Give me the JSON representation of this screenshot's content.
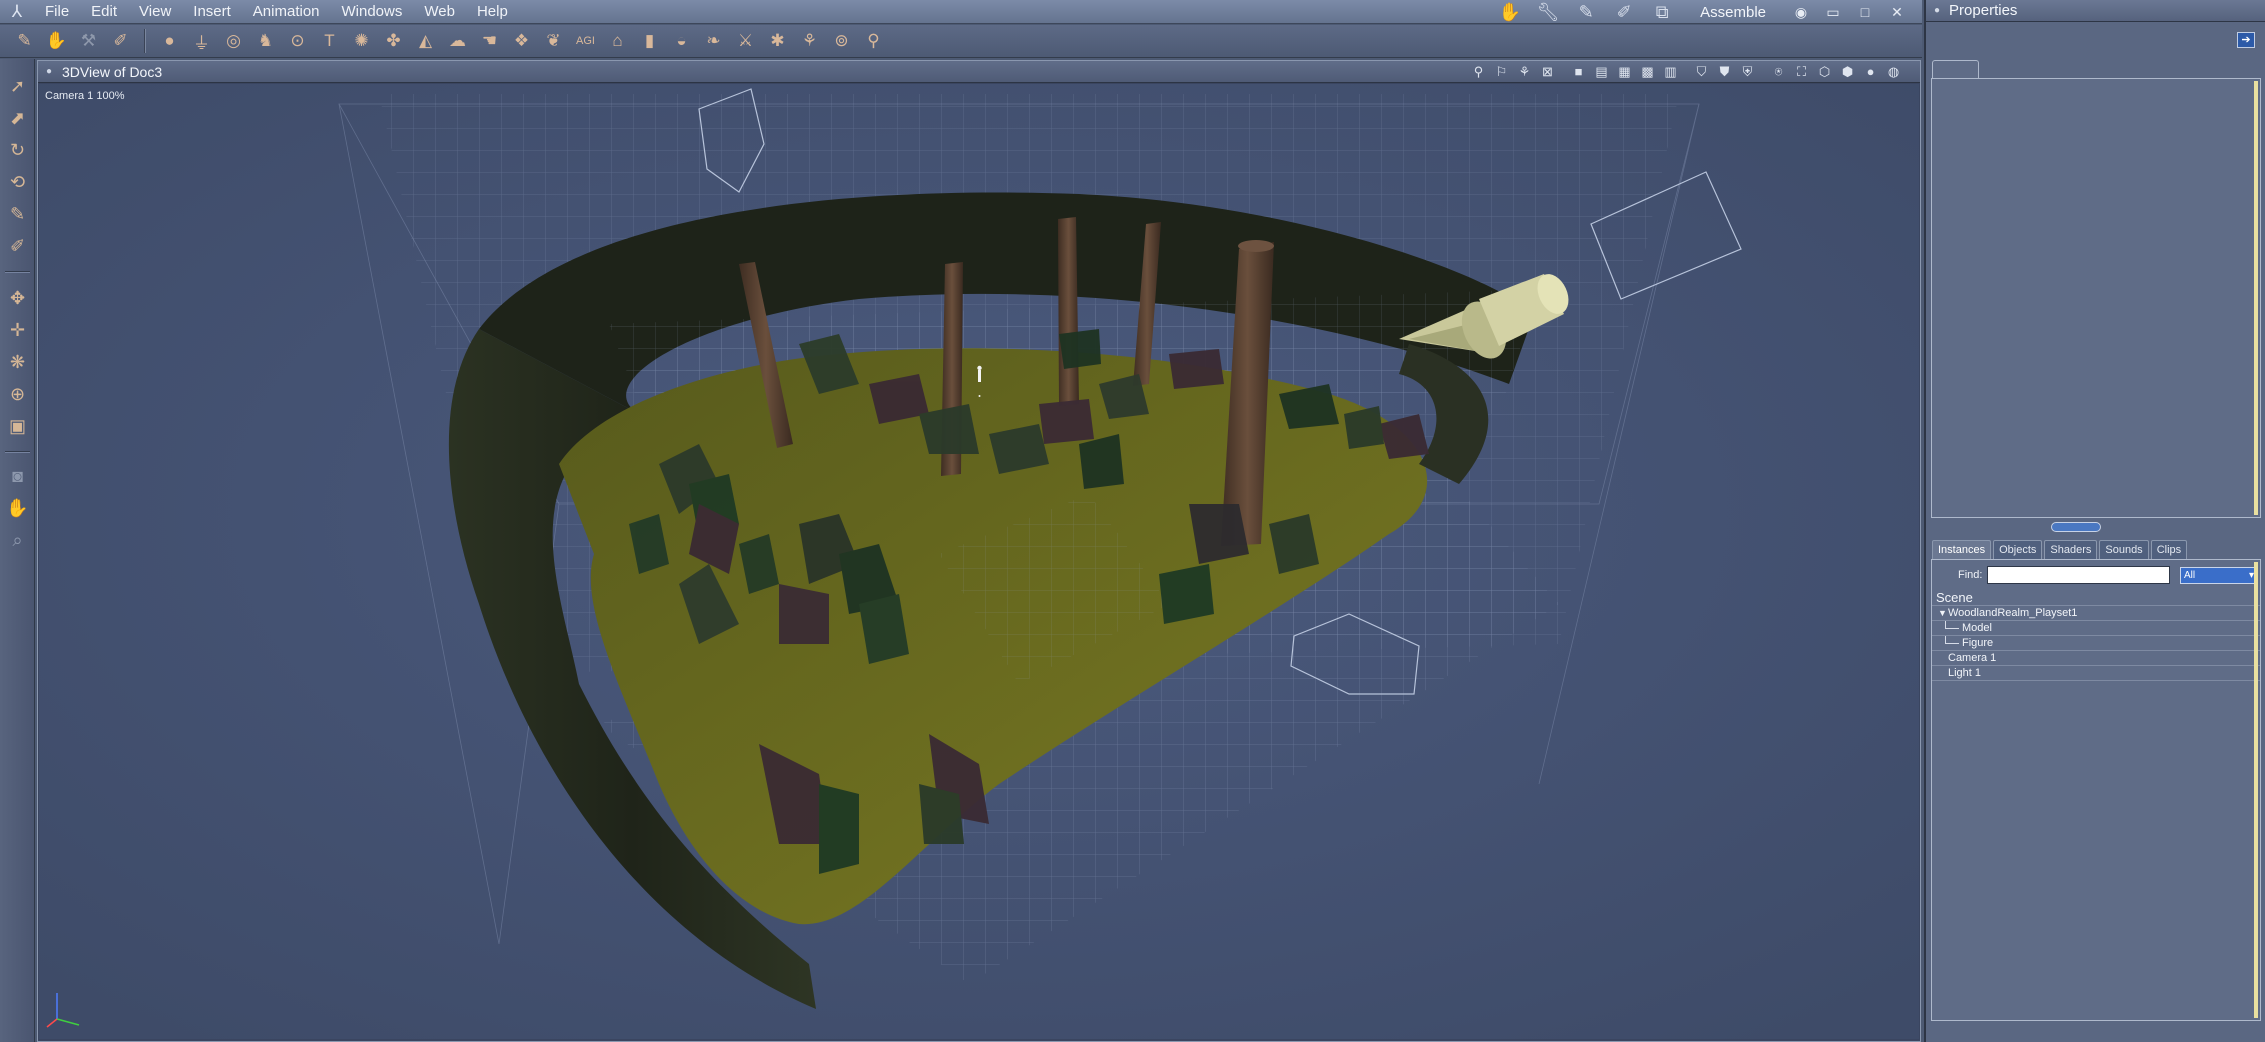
{
  "menubar": {
    "items": [
      "File",
      "Edit",
      "View",
      "Insert",
      "Animation",
      "Windows",
      "Web",
      "Help"
    ],
    "room_label": "Assemble",
    "room_icons": [
      "hand-pose-icon",
      "wrench-icon",
      "brush-icon",
      "paint-brush-icon",
      "materials-icon"
    ],
    "window_buttons": [
      "eye-icon",
      "minimize-icon",
      "maximize-icon",
      "close-icon"
    ]
  },
  "toolbar": {
    "groups": [
      [
        "pencil-icon",
        "hand-icon",
        "wrench-icon",
        "brush-icon"
      ],
      [
        "sphere-icon",
        "cylinder-icon",
        "torus-icon",
        "figure-icon",
        "ring-icon",
        "text-3d-icon",
        "gear-icon",
        "tree-icon",
        "terrain-icon",
        "cloud-icon",
        "hand-prop-icon",
        "rock-icon",
        "plant-icon",
        "agi-icon",
        "house-icon",
        "bottle-icon",
        "bowl-icon",
        "leaf-icon",
        "sword-icon",
        "bug-icon",
        "bones-icon",
        "target-icon",
        "pin-icon"
      ]
    ]
  },
  "lefttools": {
    "icons": [
      "select-arrow-icon",
      "transform-icon",
      "rotate-icon",
      "twist-icon",
      "brush-tool-icon",
      "paint-icon",
      "move-icon",
      "translate-xy-icon",
      "scale-icon",
      "universal-icon",
      "box-tool-icon",
      "camera-icon",
      "pan-hand-icon",
      "zoom-icon"
    ]
  },
  "viewport": {
    "title": "3DView of Doc3",
    "camera_label": "Camera 1  100%",
    "icons": [
      "snap-icon",
      "light-icon",
      "bones-view-icon",
      "close-view-icon",
      "single-view-icon",
      "two-view-icon",
      "three-view-icon",
      "four-view-icon",
      "six-view-icon",
      "display-mode-1-icon",
      "display-mode-2-icon",
      "display-mode-3-icon",
      "orbit-icon",
      "frame-icon",
      "cube-icon",
      "cube-solid-icon",
      "shaded-sphere-icon",
      "wire-sphere-icon"
    ]
  },
  "properties": {
    "title": "Properties",
    "tab_label": ""
  },
  "instances": {
    "tabs": [
      "Instances",
      "Objects",
      "Shaders",
      "Sounds",
      "Clips"
    ],
    "active_tab": "Instances",
    "find_label": "Find:",
    "find_value": "",
    "filter_value": "All",
    "scene_header": "Scene",
    "tree": [
      {
        "label": "WoodlandRealm_Playset1",
        "depth": 0,
        "expanded": true
      },
      {
        "label": "Model",
        "depth": 1
      },
      {
        "label": "Figure",
        "depth": 1
      },
      {
        "label": "Camera 1",
        "depth": 0
      },
      {
        "label": "Light 1",
        "depth": 0
      }
    ]
  },
  "colors": {
    "ground": "#6b6b1f",
    "wall": "#2a3020",
    "trunk": "#5e4635",
    "grid": "#8a98b8",
    "light": "#c7c79a"
  }
}
